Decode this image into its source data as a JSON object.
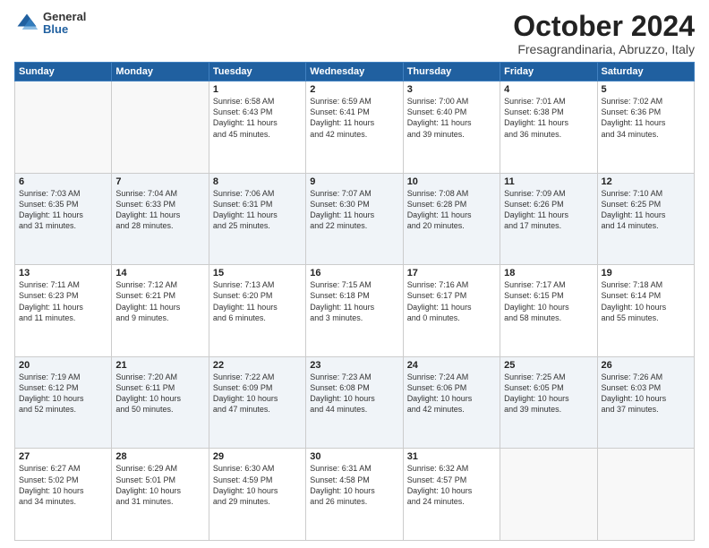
{
  "header": {
    "logo_general": "General",
    "logo_blue": "Blue",
    "month_title": "October 2024",
    "subtitle": "Fresagrandinaria, Abruzzo, Italy"
  },
  "weekdays": [
    "Sunday",
    "Monday",
    "Tuesday",
    "Wednesday",
    "Thursday",
    "Friday",
    "Saturday"
  ],
  "weeks": [
    [
      {
        "day": "",
        "info": ""
      },
      {
        "day": "",
        "info": ""
      },
      {
        "day": "1",
        "info": "Sunrise: 6:58 AM\nSunset: 6:43 PM\nDaylight: 11 hours\nand 45 minutes."
      },
      {
        "day": "2",
        "info": "Sunrise: 6:59 AM\nSunset: 6:41 PM\nDaylight: 11 hours\nand 42 minutes."
      },
      {
        "day": "3",
        "info": "Sunrise: 7:00 AM\nSunset: 6:40 PM\nDaylight: 11 hours\nand 39 minutes."
      },
      {
        "day": "4",
        "info": "Sunrise: 7:01 AM\nSunset: 6:38 PM\nDaylight: 11 hours\nand 36 minutes."
      },
      {
        "day": "5",
        "info": "Sunrise: 7:02 AM\nSunset: 6:36 PM\nDaylight: 11 hours\nand 34 minutes."
      }
    ],
    [
      {
        "day": "6",
        "info": "Sunrise: 7:03 AM\nSunset: 6:35 PM\nDaylight: 11 hours\nand 31 minutes."
      },
      {
        "day": "7",
        "info": "Sunrise: 7:04 AM\nSunset: 6:33 PM\nDaylight: 11 hours\nand 28 minutes."
      },
      {
        "day": "8",
        "info": "Sunrise: 7:06 AM\nSunset: 6:31 PM\nDaylight: 11 hours\nand 25 minutes."
      },
      {
        "day": "9",
        "info": "Sunrise: 7:07 AM\nSunset: 6:30 PM\nDaylight: 11 hours\nand 22 minutes."
      },
      {
        "day": "10",
        "info": "Sunrise: 7:08 AM\nSunset: 6:28 PM\nDaylight: 11 hours\nand 20 minutes."
      },
      {
        "day": "11",
        "info": "Sunrise: 7:09 AM\nSunset: 6:26 PM\nDaylight: 11 hours\nand 17 minutes."
      },
      {
        "day": "12",
        "info": "Sunrise: 7:10 AM\nSunset: 6:25 PM\nDaylight: 11 hours\nand 14 minutes."
      }
    ],
    [
      {
        "day": "13",
        "info": "Sunrise: 7:11 AM\nSunset: 6:23 PM\nDaylight: 11 hours\nand 11 minutes."
      },
      {
        "day": "14",
        "info": "Sunrise: 7:12 AM\nSunset: 6:21 PM\nDaylight: 11 hours\nand 9 minutes."
      },
      {
        "day": "15",
        "info": "Sunrise: 7:13 AM\nSunset: 6:20 PM\nDaylight: 11 hours\nand 6 minutes."
      },
      {
        "day": "16",
        "info": "Sunrise: 7:15 AM\nSunset: 6:18 PM\nDaylight: 11 hours\nand 3 minutes."
      },
      {
        "day": "17",
        "info": "Sunrise: 7:16 AM\nSunset: 6:17 PM\nDaylight: 11 hours\nand 0 minutes."
      },
      {
        "day": "18",
        "info": "Sunrise: 7:17 AM\nSunset: 6:15 PM\nDaylight: 10 hours\nand 58 minutes."
      },
      {
        "day": "19",
        "info": "Sunrise: 7:18 AM\nSunset: 6:14 PM\nDaylight: 10 hours\nand 55 minutes."
      }
    ],
    [
      {
        "day": "20",
        "info": "Sunrise: 7:19 AM\nSunset: 6:12 PM\nDaylight: 10 hours\nand 52 minutes."
      },
      {
        "day": "21",
        "info": "Sunrise: 7:20 AM\nSunset: 6:11 PM\nDaylight: 10 hours\nand 50 minutes."
      },
      {
        "day": "22",
        "info": "Sunrise: 7:22 AM\nSunset: 6:09 PM\nDaylight: 10 hours\nand 47 minutes."
      },
      {
        "day": "23",
        "info": "Sunrise: 7:23 AM\nSunset: 6:08 PM\nDaylight: 10 hours\nand 44 minutes."
      },
      {
        "day": "24",
        "info": "Sunrise: 7:24 AM\nSunset: 6:06 PM\nDaylight: 10 hours\nand 42 minutes."
      },
      {
        "day": "25",
        "info": "Sunrise: 7:25 AM\nSunset: 6:05 PM\nDaylight: 10 hours\nand 39 minutes."
      },
      {
        "day": "26",
        "info": "Sunrise: 7:26 AM\nSunset: 6:03 PM\nDaylight: 10 hours\nand 37 minutes."
      }
    ],
    [
      {
        "day": "27",
        "info": "Sunrise: 6:27 AM\nSunset: 5:02 PM\nDaylight: 10 hours\nand 34 minutes."
      },
      {
        "day": "28",
        "info": "Sunrise: 6:29 AM\nSunset: 5:01 PM\nDaylight: 10 hours\nand 31 minutes."
      },
      {
        "day": "29",
        "info": "Sunrise: 6:30 AM\nSunset: 4:59 PM\nDaylight: 10 hours\nand 29 minutes."
      },
      {
        "day": "30",
        "info": "Sunrise: 6:31 AM\nSunset: 4:58 PM\nDaylight: 10 hours\nand 26 minutes."
      },
      {
        "day": "31",
        "info": "Sunrise: 6:32 AM\nSunset: 4:57 PM\nDaylight: 10 hours\nand 24 minutes."
      },
      {
        "day": "",
        "info": ""
      },
      {
        "day": "",
        "info": ""
      }
    ]
  ]
}
